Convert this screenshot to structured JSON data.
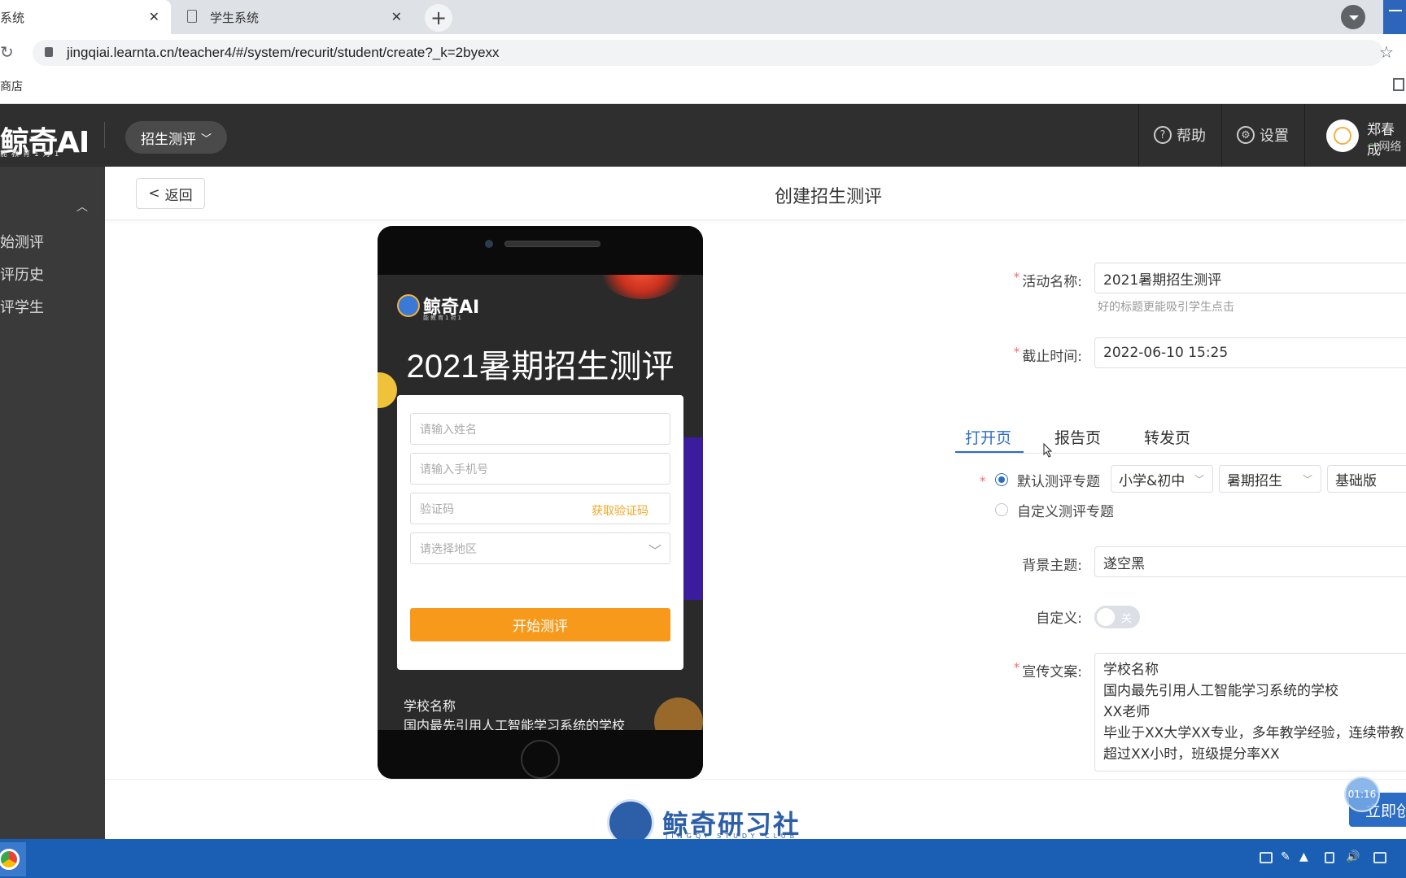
{
  "browser": {
    "tabs": [
      {
        "label": "系统",
        "active": true
      },
      {
        "label": "学生系统",
        "active": false
      }
    ],
    "url": "jingqiai.learnta.cn/teacher4/#/system/recurit/student/create?_k=2byexx",
    "bookmark": "商店"
  },
  "header": {
    "logo": "鲸奇AI",
    "logo_sub": "能教育1对1",
    "module": "招生测评",
    "help": "帮助",
    "settings": "设置",
    "user_name": "郑春成",
    "user_status": "网络"
  },
  "sidebar": {
    "items": [
      "始测评",
      "评历史",
      "评学生"
    ]
  },
  "page": {
    "back": "返回",
    "title": "创建招生测评"
  },
  "preview": {
    "logo": "鲸奇AI",
    "logo_sub": "能教育1对1",
    "title": "2021暑期招生测评",
    "name_placeholder": "请输入姓名",
    "phone_placeholder": "请输入手机号",
    "code_placeholder": "验证码",
    "get_code": "获取验证码",
    "region_placeholder": "请选择地区",
    "start": "开始测评",
    "footer_line1": "学校名称",
    "footer_line2": "国内最先引用人工智能学习系统的学校"
  },
  "form": {
    "activity_label": "活动名称:",
    "activity_value": "2021暑期招生测评",
    "activity_hint": "好的标题更能吸引学生点击",
    "deadline_label": "截止时间:",
    "deadline_value": "2022-06-10 15:25",
    "tabs": [
      "打开页",
      "报告页",
      "转发页"
    ],
    "active_tab": "打开页",
    "topic_default": "默认测评专题",
    "topic_custom": "自定义测评专题",
    "selects": [
      "小学&初中",
      "暑期招生",
      "基础版"
    ],
    "theme_label": "背景主题:",
    "theme_value": "遂空黑",
    "custom_label": "自定义:",
    "custom_toggle": "关",
    "custom_on": false,
    "promo_label": "宣传文案:",
    "promo_lines": [
      "学校名称",
      "国内最先引用人工智能学习系统的学校",
      "XX老师",
      "毕业于XX大学XX专业，多年教学经验，连续带教",
      "超过XX小时，班级提分率XX"
    ]
  },
  "footer": {
    "brand": "鲸奇研习社",
    "brand_sub": "JINGQI STUDY CLUB",
    "submit": "立即创",
    "timer": "01:16"
  },
  "colors": {
    "primary": "#2b6cc4",
    "accent_orange": "#f79a1b",
    "header_dark": "#2f2f2f",
    "required": "#f56c6c"
  }
}
